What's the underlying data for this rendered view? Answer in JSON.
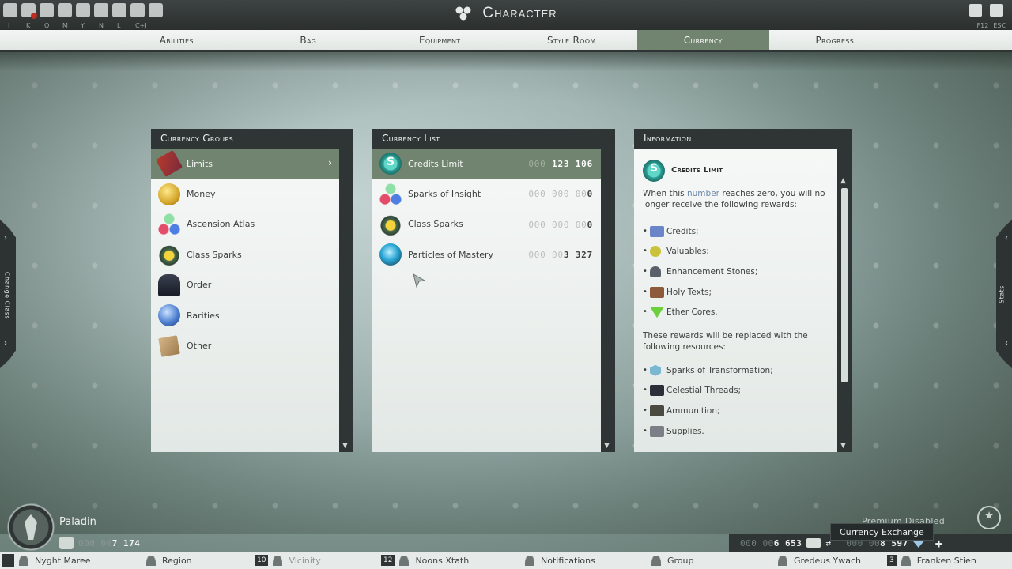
{
  "header": {
    "title": "Character",
    "quick_icons": [
      "character-icon",
      "inventory-alert-icon",
      "settings-flower-icon",
      "map-icon",
      "chat-icon",
      "mount-icon",
      "guild-icon",
      "wing-icon",
      "gear-icon"
    ],
    "hotkeys": [
      "I",
      "K",
      "O",
      "M",
      "Y",
      "N",
      "L",
      "C+J"
    ],
    "right_keys": [
      "F12",
      "ESC"
    ]
  },
  "tabs": [
    {
      "label": "Abilities",
      "active": false
    },
    {
      "label": "Bag",
      "active": false
    },
    {
      "label": "Equipment",
      "active": false
    },
    {
      "label": "Style Room",
      "active": false
    },
    {
      "label": "Currency",
      "active": true
    },
    {
      "label": "Progress",
      "active": false
    }
  ],
  "side": {
    "left_label": "Change Class",
    "right_label": "Stats"
  },
  "groups_panel": {
    "header": "Currency Groups",
    "items": [
      {
        "label": "Limits",
        "icon": "limits-icon",
        "selected": true
      },
      {
        "label": "Money",
        "icon": "money-icon",
        "selected": false
      },
      {
        "label": "Ascension Atlas",
        "icon": "ascension-atlas-icon",
        "selected": false
      },
      {
        "label": "Class Sparks",
        "icon": "class-sparks-icon",
        "selected": false
      },
      {
        "label": "Order",
        "icon": "order-icon",
        "selected": false
      },
      {
        "label": "Rarities",
        "icon": "rarities-icon",
        "selected": false
      },
      {
        "label": "Other",
        "icon": "other-icon",
        "selected": false
      }
    ]
  },
  "list_panel": {
    "header": "Currency List",
    "items": [
      {
        "label": "Credits Limit",
        "icon": "credits-limit-icon",
        "pad": "000 ",
        "value": "123 106",
        "selected": true
      },
      {
        "label": "Sparks of Insight",
        "icon": "sparks-of-insight-icon",
        "pad": "000 000 00",
        "value": "0",
        "selected": false
      },
      {
        "label": "Class Sparks",
        "icon": "class-sparks-icon",
        "pad": "000 000 00",
        "value": "0",
        "selected": false
      },
      {
        "label": "Particles of Mastery",
        "icon": "particles-of-mastery-icon",
        "pad": "000 00",
        "value": "3 327",
        "selected": false
      }
    ]
  },
  "info_panel": {
    "header": "Information",
    "title": "Credits Limit",
    "para1_pre": "When this ",
    "para1_hl": "number",
    "para1_post": " reaches zero, you will no longer receive the following rewards:",
    "rewards": [
      {
        "label": "Credits;",
        "icon": "credits-icon",
        "color": "#6a86c9"
      },
      {
        "label": "Valuables;",
        "icon": "valuables-icon",
        "color": "#c9c23a"
      },
      {
        "label": "Enhancement Stones;",
        "icon": "enhancement-stones-icon",
        "color": "#59606a"
      },
      {
        "label": "Holy Texts;",
        "icon": "holy-texts-icon",
        "color": "#8d5a3b"
      },
      {
        "label": "Ether Cores.",
        "icon": "ether-cores-icon",
        "color": "#6ecf3d"
      }
    ],
    "para2": "These rewards will be replaced with the following resources:",
    "resources": [
      {
        "label": "Sparks of Transformation;",
        "icon": "sparks-of-transformation-icon",
        "color": "#7ab7d1"
      },
      {
        "label": "Celestial Threads;",
        "icon": "celestial-threads-icon",
        "color": "#2c2f3a"
      },
      {
        "label": "Ammunition;",
        "icon": "ammunition-icon",
        "color": "#4a4a40"
      },
      {
        "label": "Supplies.",
        "icon": "supplies-icon",
        "color": "#7c7f86"
      }
    ]
  },
  "character": {
    "class_name": "Paladin",
    "currency_pad": "000 00",
    "currency_value": "7 174"
  },
  "premium": {
    "label": "Premium Disabled"
  },
  "wallet": {
    "credits_pad": "000 00",
    "credits_value": "6 653",
    "crystals_pad": "000 00",
    "crystals_value": "8 597",
    "tooltip": "Currency Exchange"
  },
  "chatbar": [
    {
      "label": "Nyght Maree",
      "count": "",
      "dim": false
    },
    {
      "label": "Region",
      "count": "",
      "dim": false
    },
    {
      "label": "Vicinity",
      "count": "10",
      "dim": true
    },
    {
      "label": "Noons Xtath",
      "count": "12",
      "dim": false
    },
    {
      "label": "Notifications",
      "count": "",
      "dim": false
    },
    {
      "label": "Group",
      "count": "",
      "dim": false
    },
    {
      "label": "Gredeus Ywach",
      "count": "",
      "dim": false
    },
    {
      "label": "Franken Stien",
      "count": "3",
      "dim": false
    }
  ]
}
